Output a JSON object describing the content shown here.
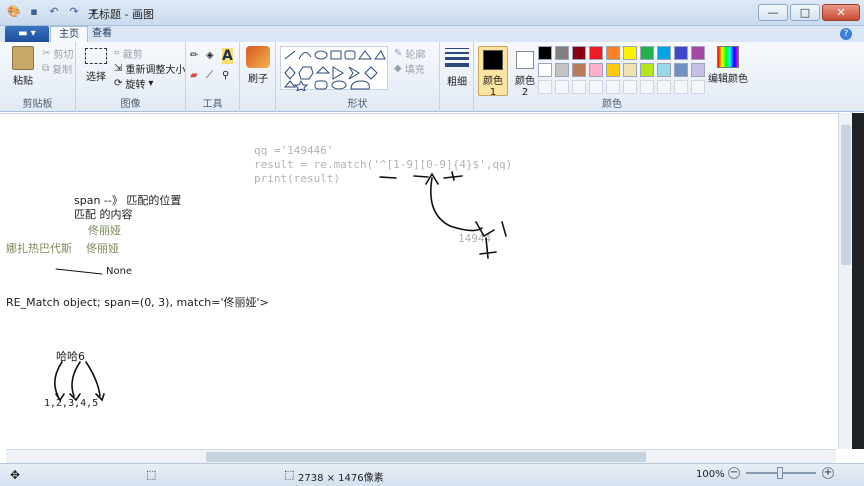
{
  "window": {
    "title": "无标题 - 画图",
    "controls": {
      "minimize": "—",
      "maximize": "□",
      "close": "✕"
    }
  },
  "tabs": {
    "file": "▬ ▾",
    "home": "主页",
    "view": "查看",
    "help": "?"
  },
  "ribbon": {
    "clipboard": {
      "label": "剪贴板",
      "paste": "粘贴",
      "cut": "剪切",
      "copy": "复制"
    },
    "image": {
      "label": "图像",
      "select": "选择",
      "crop": "裁剪",
      "resize": "重新调整大小",
      "rotate": "旋转"
    },
    "tools": {
      "label": "工具",
      "brush": "刷子"
    },
    "shapes": {
      "label": "形状",
      "outline": "轮廓",
      "fill": "填充"
    },
    "size": {
      "label": "粗细"
    },
    "colors": {
      "label": "颜色",
      "color1": "颜色 1",
      "color2": "颜色 2",
      "edit": "编辑颜色",
      "color1_value": "#000000",
      "color2_value": "#ffffff",
      "palette_row1": [
        "#000000",
        "#7f7f7f",
        "#880015",
        "#ed1c24",
        "#ff7f27",
        "#fff200",
        "#22b14c",
        "#00a2e8",
        "#3f48cc",
        "#a349a4"
      ],
      "palette_row2": [
        "#ffffff",
        "#c3c3c3",
        "#b97a57",
        "#ffaec9",
        "#ffc90e",
        "#efe4b0",
        "#b5e61d",
        "#99d9ea",
        "#7092be",
        "#c8bfe7"
      ]
    }
  },
  "canvas": {
    "code_line1": "qq ='149446'",
    "code_line2": "result = re.match('^[1-9][0-9]{4}$',qq)",
    "code_line3": "print(result)",
    "number_result": "14944",
    "note_span": "span --》 匹配的位置",
    "note_match": "匹配 的内容",
    "name1": "佟丽娅",
    "name_left": "娜扎热巴代斯",
    "name2": "佟丽娅",
    "none_label": "None",
    "match_object": "RE_Match object; span=(0, 3), match='佟丽娅'>",
    "haha": "哈哈6",
    "numbers": "1,2,3,4,5"
  },
  "status": {
    "dimensions": "2738 × 1476像素",
    "zoom": "100%",
    "zoom_out": "−",
    "zoom_in": "+"
  }
}
